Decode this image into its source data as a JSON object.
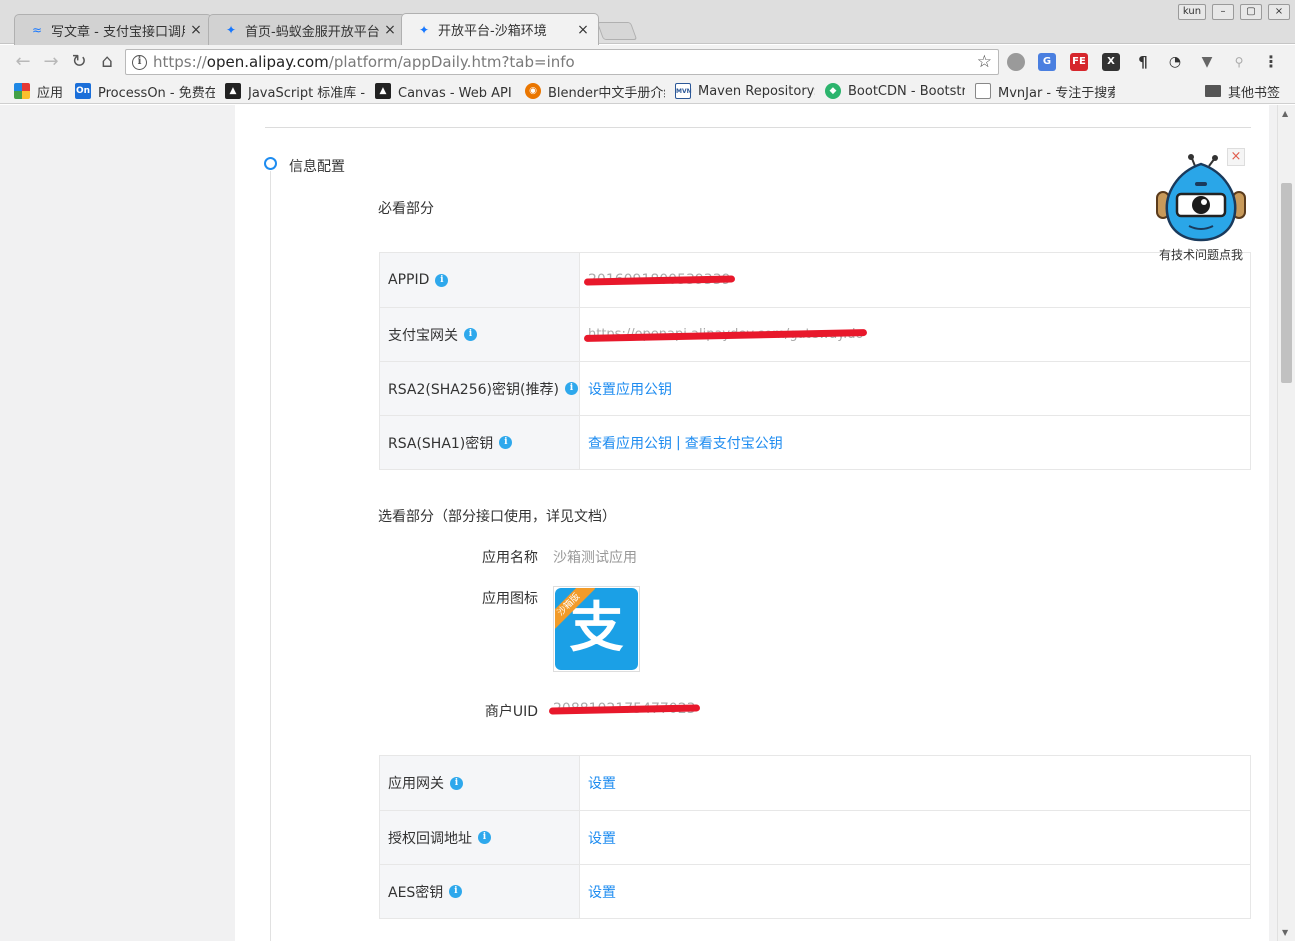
{
  "browser": {
    "tabs": [
      {
        "title": "写文章 - 支付宝接口调用",
        "active": false
      },
      {
        "title": "首页-蚂蚁金服开放平台",
        "active": false
      },
      {
        "title": "开放平台-沙箱环境",
        "active": true
      }
    ],
    "window_user": "kun",
    "url_prefix": "https://",
    "url_host": "open.alipay.com",
    "url_path": "/platform/appDaily.htm?tab=info",
    "bookmarks": [
      {
        "label": "应用"
      },
      {
        "label": "ProcessOn - 免费在线"
      },
      {
        "label": "JavaScript 标准库 - J"
      },
      {
        "label": "Canvas - Web API 接"
      },
      {
        "label": "Blender中文手册介绍"
      },
      {
        "label": "Maven Repository: S"
      },
      {
        "label": "BootCDN - Bootstrap"
      },
      {
        "label": "MvnJar - 专注于搜索"
      }
    ],
    "other_bookmarks": "其他书签"
  },
  "page": {
    "section_title": "信息配置",
    "required": {
      "title": "必看部分",
      "rows": [
        {
          "label": "APPID",
          "value": "2016091800539339",
          "redacted": true
        },
        {
          "label": "支付宝网关",
          "value": "https://openapi.alipaydev.com/gateway.do",
          "redacted": true
        },
        {
          "label": "RSA2(SHA256)密钥(推荐)",
          "link1": "设置应用公钥"
        },
        {
          "label": "RSA(SHA1)密钥",
          "link1": "查看应用公钥",
          "separator": "|",
          "link2": "查看支付宝公钥"
        }
      ]
    },
    "optional": {
      "title": "选看部分（部分接口使用，详见文档）",
      "app_name_label": "应用名称",
      "app_name_value": "沙箱测试应用",
      "app_icon_label": "应用图标",
      "app_icon_char": "支",
      "app_icon_ribbon": "沙箱版",
      "merchant_uid_label": "商户UID",
      "merchant_uid_value": "2088102175477023",
      "rows": [
        {
          "label": "应用网关",
          "link1": "设置"
        },
        {
          "label": "授权回调地址",
          "link1": "设置"
        },
        {
          "label": "AES密钥",
          "link1": "设置"
        }
      ]
    },
    "helper_text": "有技术问题点我",
    "info_badge": "i"
  },
  "colors": {
    "accent": "#1e8cf0",
    "info": "#2ea8ec",
    "redaction": "#e8182b"
  }
}
